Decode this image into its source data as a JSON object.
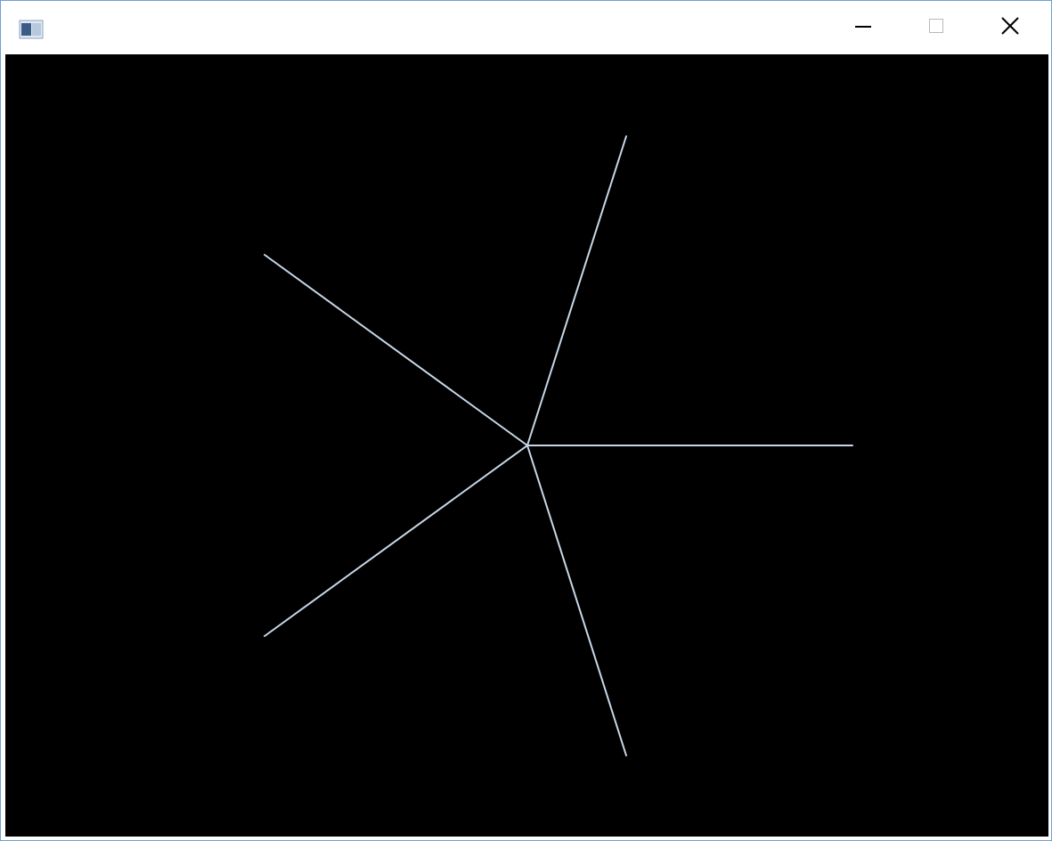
{
  "window": {
    "title": "",
    "icon": "app-window-icon",
    "controls": [
      {
        "name": "minimize",
        "icon": "minimize-icon"
      },
      {
        "name": "maximize",
        "icon": "maximize-icon"
      },
      {
        "name": "close",
        "icon": "close-icon"
      }
    ]
  },
  "canvas": {
    "background": "#000000",
    "line_color": "#c8d8e8",
    "shape": "five-spoke-star",
    "spoke_count": 5
  }
}
